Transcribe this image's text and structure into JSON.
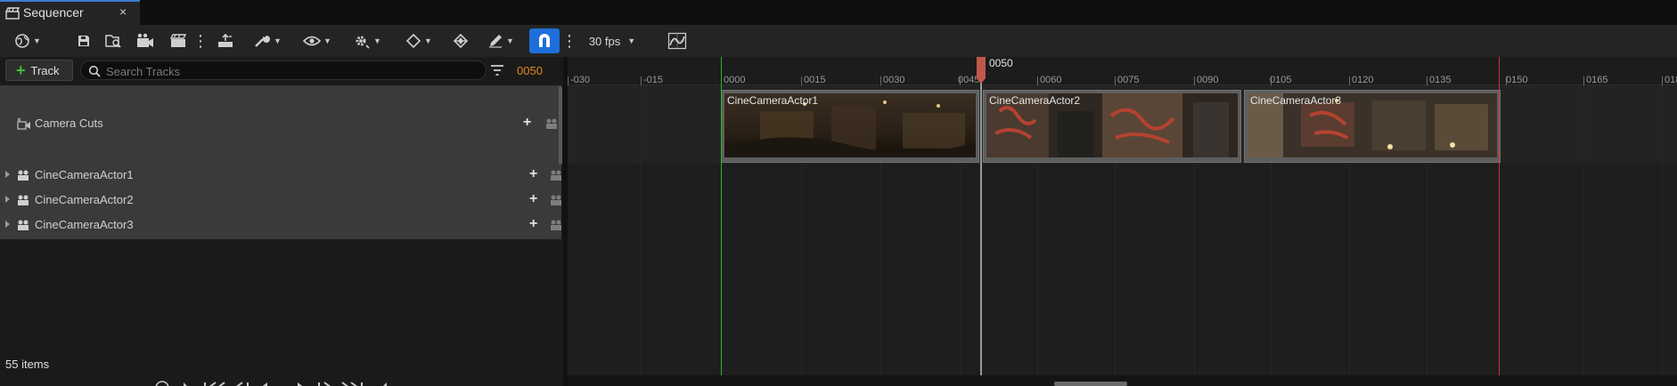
{
  "tab": {
    "title": "Sequencer",
    "close": "×",
    "icon": "sequencer-clapper-icon"
  },
  "toolbar": {
    "fps_label": "30 fps",
    "icons": [
      "world-icon",
      "save-icon",
      "browse-icon",
      "render-movie-icon",
      "clapper-icon",
      "more-icon",
      "export-icon",
      "wrench-icon",
      "eye-icon",
      "gear-icon",
      "key-icon",
      "key-tangent-icon",
      "pencil-icon",
      "snap-magnet-icon",
      "more-icon",
      "curve-editor-icon"
    ]
  },
  "left_panel": {
    "add_track_label": "Track",
    "search_placeholder": "Search Tracks",
    "current_frame": "0050",
    "tracks": [
      {
        "label": "Camera Cuts",
        "icon": "camera-cuts-icon"
      },
      {
        "label": "CineCameraActor1",
        "icon": "camera-actor-icon"
      },
      {
        "label": "CineCameraActor2",
        "icon": "camera-actor-icon"
      },
      {
        "label": "CineCameraActor3",
        "icon": "camera-actor-icon"
      }
    ],
    "items_count": "55 items"
  },
  "timeline": {
    "ticks": [
      "-030",
      "-015",
      "0000",
      "0015",
      "0030",
      "0045",
      "0060",
      "0075",
      "0090",
      "0105",
      "0120",
      "0135",
      "0150",
      "0165",
      "018"
    ],
    "playhead_label": "0050",
    "playhead_frame": 50,
    "sections": [
      {
        "title": "CineCameraActor1"
      },
      {
        "title": "CineCameraActor2"
      },
      {
        "title": "CineCameraActor3"
      }
    ],
    "colors": {
      "start_marker": "#31b331",
      "end_marker": "#cc3333",
      "playhead": "#c0584a",
      "snap_active": "#1e6fd9",
      "frame_readout": "#e08a1e"
    }
  }
}
